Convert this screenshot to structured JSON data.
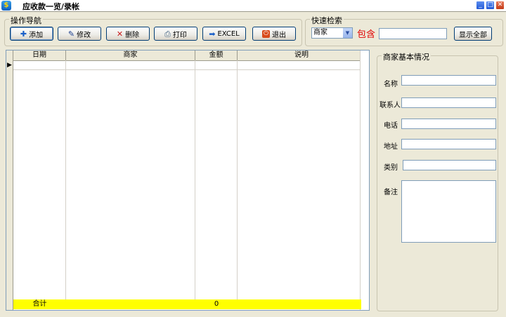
{
  "window": {
    "title": "应收款一览/录帐",
    "app_icon_glyph": "$"
  },
  "toolbar": {
    "group_title": "操作导航",
    "add_label": "添加",
    "edit_label": "修改",
    "delete_label": "删除",
    "print_label": "打印",
    "excel_label": "EXCEL",
    "exit_label": "退出"
  },
  "search": {
    "group_title": "快速检索",
    "field_selected": "商家",
    "contains_label": "包含",
    "keyword_value": "",
    "show_all_label": "显示全部"
  },
  "grid": {
    "columns": [
      "日期",
      "商家",
      "金额",
      "说明"
    ],
    "rows": [],
    "footer": {
      "label": "合计",
      "amount_total": "0"
    }
  },
  "merchant_panel": {
    "group_title": "商家基本情况",
    "name_label": "名称",
    "contact_label": "联系人",
    "phone_label": "电话",
    "address_label": "地址",
    "category_label": "类别",
    "notes_label": "备注",
    "name_value": "",
    "contact_value": "",
    "phone_value": "",
    "address_value": "",
    "category_value": "",
    "notes_value": ""
  },
  "icons": {
    "add": "plus-icon",
    "edit": "pen-icon",
    "delete": "x-icon",
    "print": "printer-icon",
    "excel": "arrow-right-icon",
    "exit": "exit-icon"
  }
}
